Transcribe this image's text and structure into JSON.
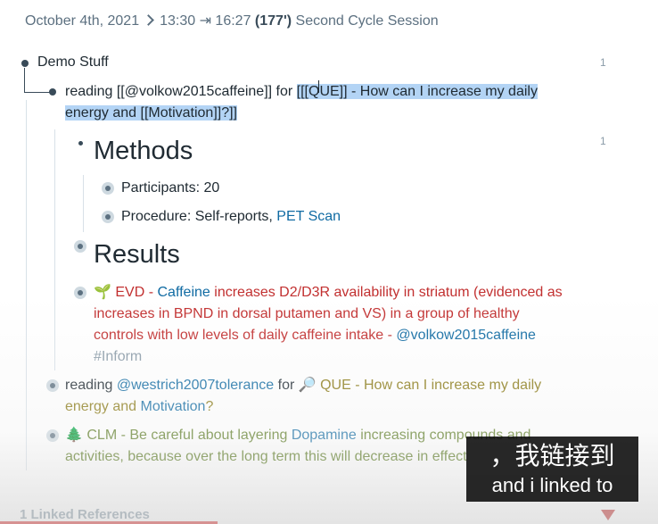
{
  "breadcrumb": {
    "date": "October 4th, 2021",
    "time_range": "13:30 ⇥ 16:27",
    "duration": "(177')",
    "title": "Second Cycle Session"
  },
  "blocks": {
    "demo": {
      "text": "Demo Stuff",
      "count": "1"
    },
    "reading1": {
      "prefix": "reading [[@volkow2015caffeine]] for ",
      "highlighted_line1": "[[[QUE]] - How can I increase my daily",
      "highlighted_line2": "energy and [[Motivation]]?]]"
    },
    "methods": {
      "title": "Methods",
      "count": "1"
    },
    "participants": "Participants: 20",
    "procedure": {
      "label": "Procedure: Self-reports, ",
      "link": "PET Scan"
    },
    "results": {
      "title": "Results"
    },
    "evd": {
      "icon": "🌱",
      "tag": "EVD - ",
      "link": "Caffeine",
      "line1_rest": " increases D2/D3R availability in striatum (evidenced as",
      "line2": "increases in BPND in dorsal putamen and VS) in a group of healthy",
      "line3": "controls with low levels of daily caffeine intake - ",
      "line3_link": "@volkow2015caffeine",
      "line4": "#Inform"
    },
    "reading2": {
      "prefix": "reading ",
      "link": "@westrich2007tolerance",
      "for": " for ",
      "icon": "🔎",
      "que_line1": " QUE - How can I increase my daily",
      "que_line2a": "energy and ",
      "que_link": "Motivation",
      "que_line2b": "?"
    },
    "clm": {
      "icon": "🌲",
      "line1a": " CLM - Be careful about layering ",
      "link": "Dopamine",
      "line1b": " increasing compounds and",
      "line2": "activities, because over the long term this will decrease in effect"
    }
  },
  "linked_refs": "1 Linked References",
  "subtitle": {
    "zh": "，我链接到",
    "en": "and i linked to"
  },
  "colors": {
    "accent": "#106ba3",
    "evidence": "#c23030",
    "question": "#8a7a15",
    "claim": "#5a7a20"
  }
}
